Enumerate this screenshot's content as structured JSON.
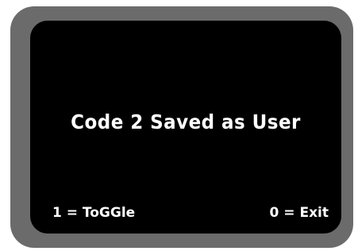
{
  "display": {
    "message": "Code 2 Saved as User",
    "left_softkey": "1 = ToGGle",
    "right_softkey": "0 = Exit"
  },
  "colors": {
    "bezel": "#6b6b6b",
    "screen": "#000000",
    "text": "#ffffff"
  }
}
